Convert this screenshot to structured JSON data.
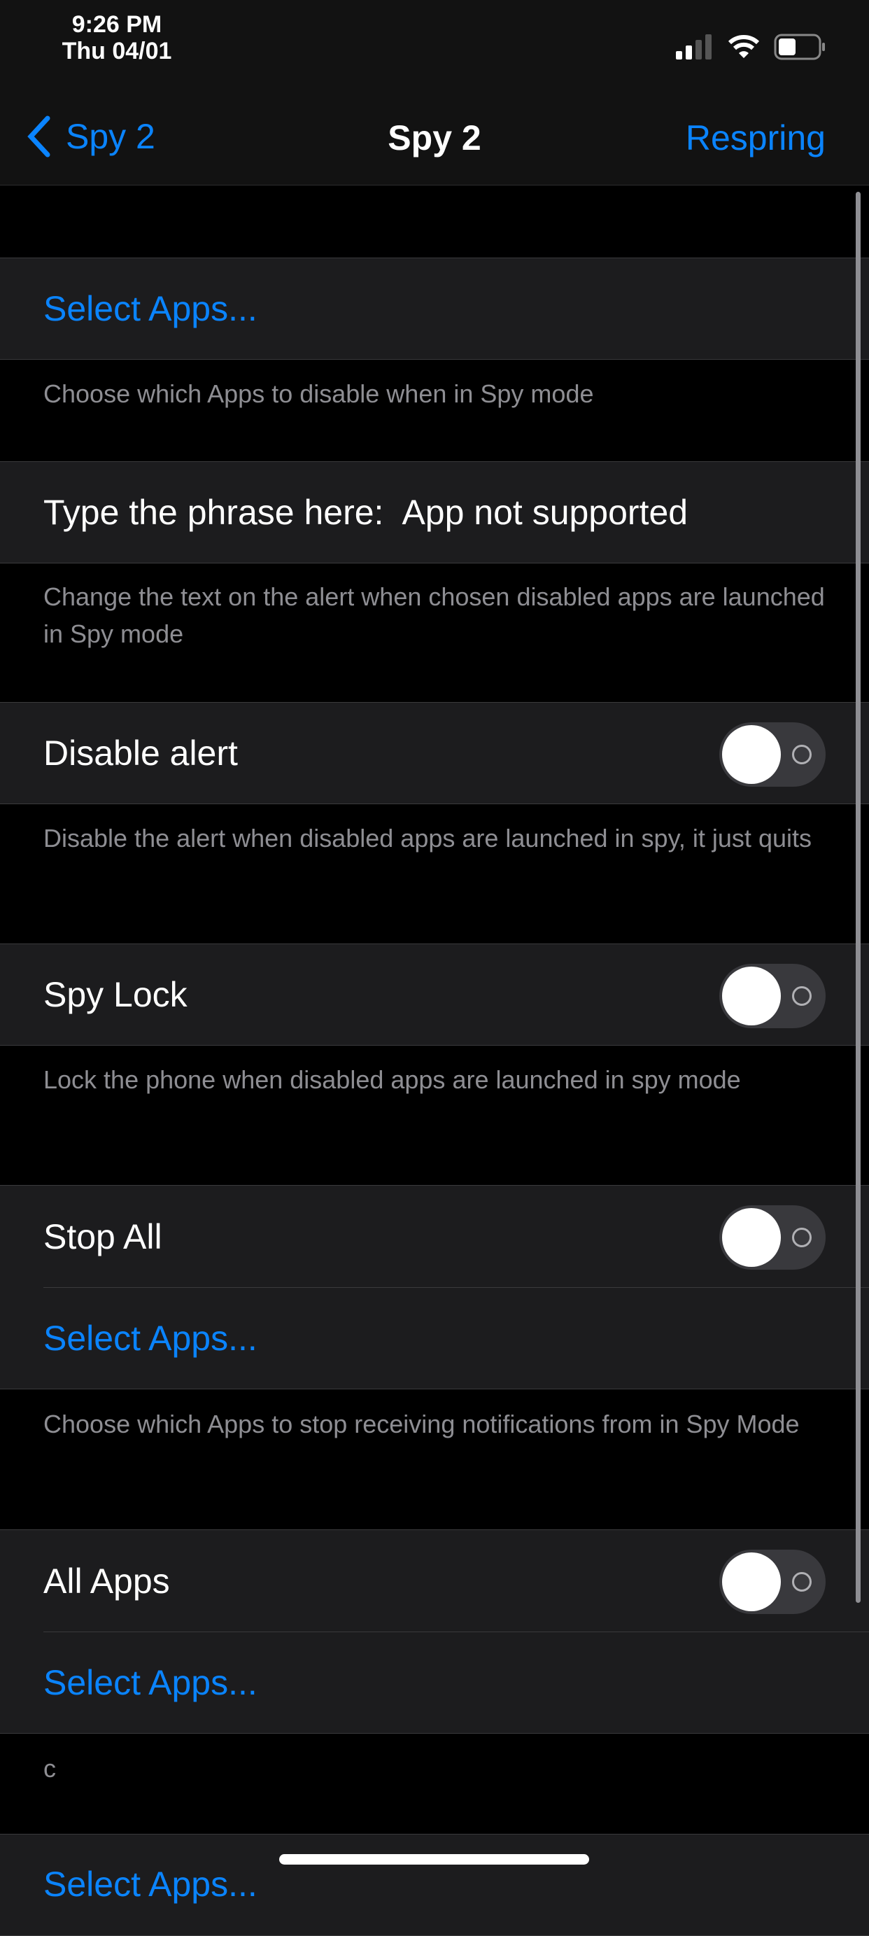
{
  "status_bar": {
    "time": "9:26 PM",
    "date": "Thu 04/01"
  },
  "nav": {
    "back_label": "Spy 2",
    "title": "Spy 2",
    "right_button": "Respring"
  },
  "sections": [
    {
      "cell": "Select Apps...",
      "footer": "Choose which Apps to disable when in Spy mode"
    },
    {
      "label": "Type the phrase here:",
      "value": "App not supported",
      "footer": "Change the text on the alert when chosen disabled apps are launched in Spy mode"
    },
    {
      "label": "Disable alert",
      "toggle": false,
      "footer": "Disable the alert when disabled apps are launched in spy, it just quits"
    },
    {
      "label": "Spy Lock",
      "toggle": false,
      "footer": "Lock the phone when disabled apps are launched in spy mode"
    },
    {
      "label": "Stop All",
      "toggle": false,
      "link": "Select Apps...",
      "footer": "Choose which Apps to stop receiving notifications from in Spy Mode"
    },
    {
      "label": "All Apps",
      "toggle": false,
      "link": "Select Apps...",
      "footer": "c"
    },
    {
      "link": "Select Apps..."
    }
  ]
}
